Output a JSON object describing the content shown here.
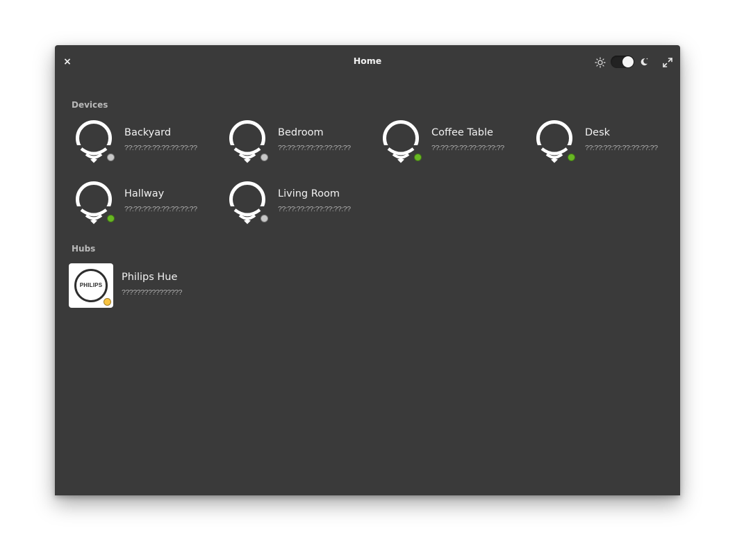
{
  "window": {
    "title": "Home",
    "close_glyph": "×"
  },
  "header_controls": {
    "theme_toggle": "dark",
    "light_icon": "sun-icon",
    "dark_icon": "moon-icon",
    "maximize_icon": "maximize-icon"
  },
  "sections": {
    "devices_label": "Devices",
    "hubs_label": "Hubs"
  },
  "devices": [
    {
      "name": "Backyard",
      "id": "??:??:??:??:??:??:??:??",
      "status": "offline",
      "status_color": "#c8c8c8"
    },
    {
      "name": "Bedroom",
      "id": "??:??:??:??:??:??:??:??",
      "status": "offline",
      "status_color": "#c8c8c8"
    },
    {
      "name": "Coffee Table",
      "id": "??:??:??:??:??:??:??:??",
      "status": "online",
      "status_color": "#68b723"
    },
    {
      "name": "Desk",
      "id": "??:??:??:??:??:??:??:??",
      "status": "online",
      "status_color": "#68b723"
    },
    {
      "name": "Hallway",
      "id": "??:??:??:??:??:??:??:??",
      "status": "online",
      "status_color": "#68b723"
    },
    {
      "name": "Living Room",
      "id": "??:??:??:??:??:??:??:??",
      "status": "offline",
      "status_color": "#c8c8c8"
    }
  ],
  "hubs": [
    {
      "name": "Philips Hue",
      "id": "????????????????",
      "logo_text": "PHILIPS",
      "status": "pending",
      "status_color": "#f9c440"
    }
  ]
}
